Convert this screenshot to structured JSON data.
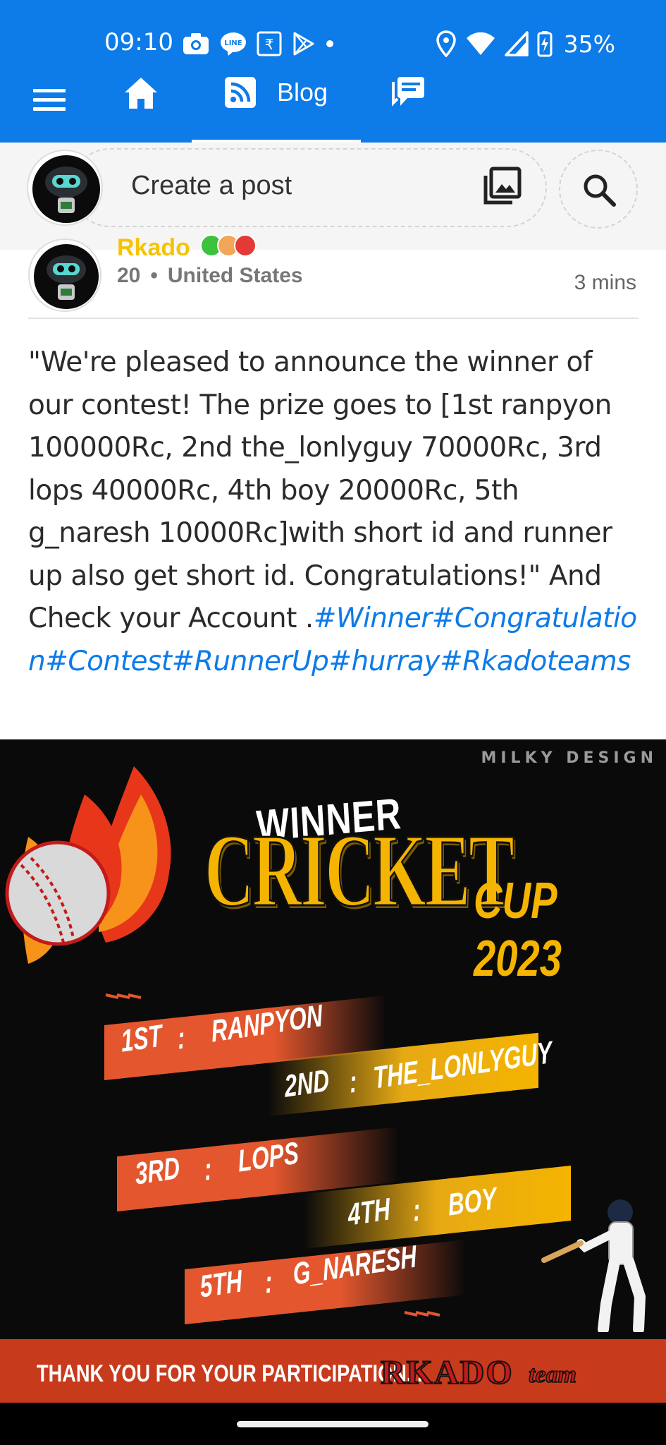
{
  "status_bar": {
    "time": "09:10",
    "battery": "35%",
    "icons": [
      "camera-icon",
      "line-app-icon",
      "rupee-icon",
      "play-store-icon",
      "dot-icon",
      "location-icon",
      "wifi-icon",
      "signal-icon",
      "battery-charging-icon"
    ]
  },
  "nav": {
    "tabs": [
      {
        "icon": "menu-icon"
      },
      {
        "icon": "home-icon"
      },
      {
        "icon": "rss-icon",
        "label": "Blog",
        "active": true
      },
      {
        "icon": "messages-icon"
      }
    ]
  },
  "create_post": {
    "placeholder": "Create a post",
    "photo_icon": "photo-library-icon",
    "search_icon": "search-icon"
  },
  "post": {
    "author_name": "Rkado",
    "author_level": "20",
    "author_country": "United States",
    "time": "3 mins",
    "text": "\"We're pleased to announce the winner of our contest! The prize goes to [1st ranpyon 100000Rc, 2nd the_lonlyguy 70000Rc, 3rd lops 40000Rc, 4th boy 20000Rc, 5th g_naresh 10000Rc]with short id and runner up also get short id. Congratulations!\" And Check your Account .",
    "hashtags": "#Winner#Congratulation#Contest#RunnerUp#hurray#Rkadoteams",
    "badge_colors": [
      "#3cc23c",
      "#f2a65a",
      "#e53935"
    ]
  },
  "poster": {
    "watermark": "MILKY DESIGN",
    "winner": "WINNER",
    "title": "CRICKET",
    "subtitle": "CUP 2023",
    "ranks": [
      {
        "place": "1ST",
        "name": "RANPYON"
      },
      {
        "place": "2ND",
        "name": "THE_LONLYGUY"
      },
      {
        "place": "3RD",
        "name": "LOPS"
      },
      {
        "place": "4TH",
        "name": "BOY"
      },
      {
        "place": "5TH",
        "name": "G_NARESH"
      }
    ],
    "separator": ":",
    "footer_text": "THANK YOU FOR YOUR PARTICIPATION...",
    "brand_main": "RKADO",
    "brand_sub": "team",
    "colors": {
      "gold": "#f5b400",
      "orange": "#e4572e",
      "footer": "#c83a1c"
    }
  }
}
